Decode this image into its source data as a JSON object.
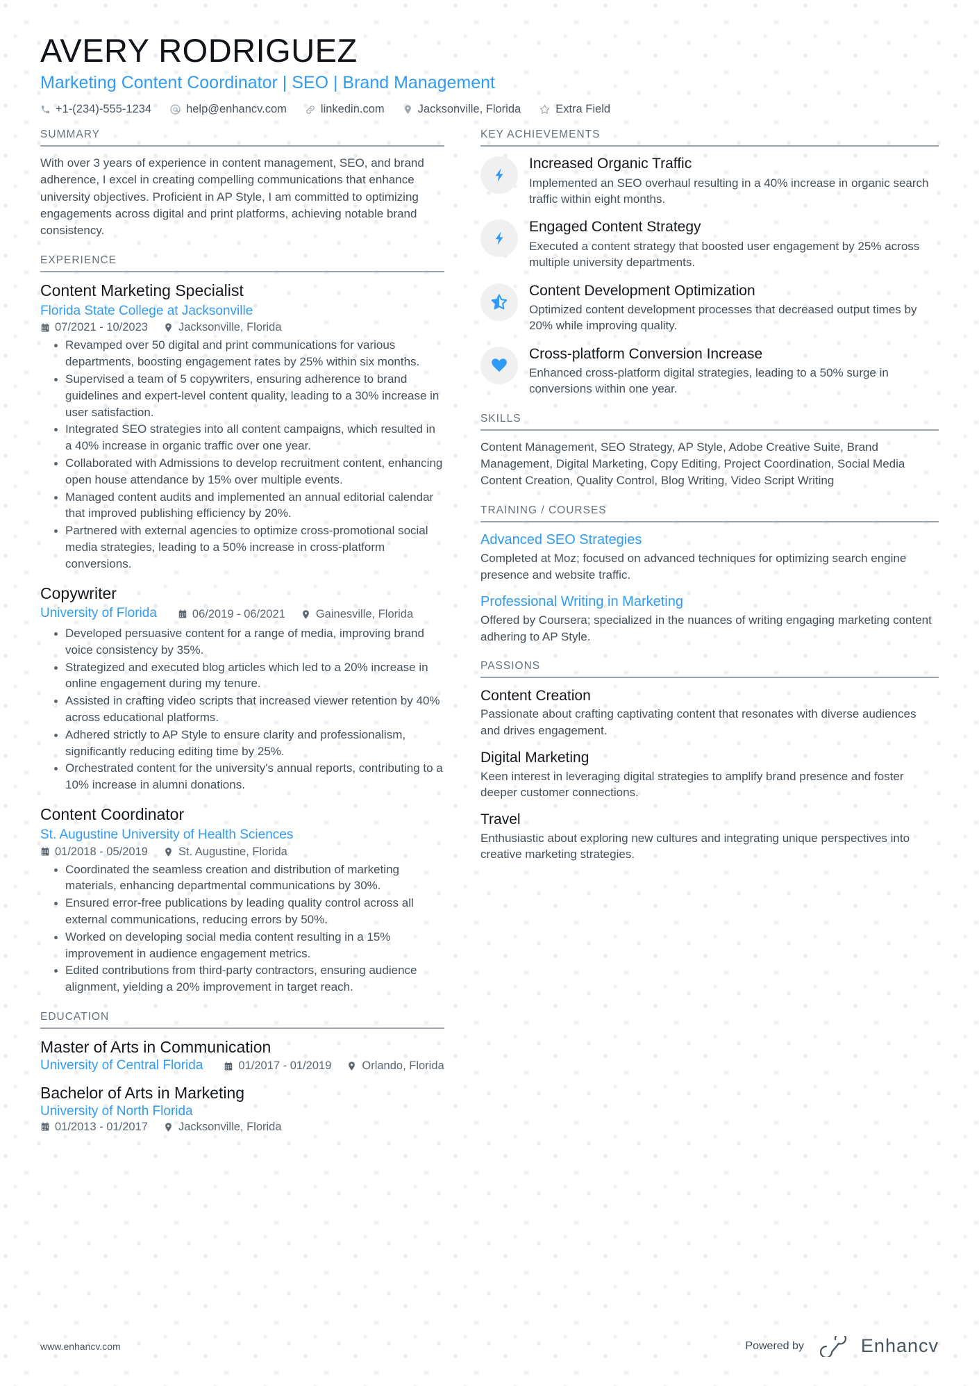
{
  "header": {
    "name": "AVERY RODRIGUEZ",
    "headline": "Marketing Content Coordinator | SEO | Brand Management",
    "contacts": [
      {
        "icon": "phone-icon",
        "text": "+1-(234)-555-1234"
      },
      {
        "icon": "email-icon",
        "text": "help@enhancv.com"
      },
      {
        "icon": "link-icon",
        "text": "linkedin.com"
      },
      {
        "icon": "location-icon",
        "text": "Jacksonville, Florida"
      },
      {
        "icon": "star-icon",
        "text": "Extra Field"
      }
    ]
  },
  "accent_color": "#2f9bf7",
  "left": {
    "summary": {
      "heading": "SUMMARY",
      "text": "With over 3 years of experience in content management, SEO, and brand adherence, I excel in creating compelling communications that enhance university objectives. Proficient in AP Style, I am committed to optimizing engagements across digital and print platforms, achieving notable brand consistency."
    },
    "experience": {
      "heading": "EXPERIENCE",
      "jobs": [
        {
          "title": "Content Marketing Specialist",
          "company": "Florida State College at Jacksonville",
          "dates": "07/2021 - 10/2023",
          "location": "Jacksonville, Florida",
          "inline_meta": false,
          "bullets": [
            "Revamped over 50 digital and print communications for various departments, boosting engagement rates by 25% within six months.",
            "Supervised a team of 5 copywriters, ensuring adherence to brand guidelines and expert-level content quality, leading to a 30% increase in user satisfaction.",
            "Integrated SEO strategies into all content campaigns, which resulted in a 40% increase in organic traffic over one year.",
            "Collaborated with Admissions to develop recruitment content, enhancing open house attendance by 15% over multiple events.",
            "Managed content audits and implemented an annual editorial calendar that improved publishing efficiency by 20%.",
            "Partnered with external agencies to optimize cross-promotional social media strategies, leading to a 50% increase in cross-platform conversions."
          ]
        },
        {
          "title": "Copywriter",
          "company": "University of Florida",
          "dates": "06/2019 - 06/2021",
          "location": "Gainesville, Florida",
          "inline_meta": true,
          "bullets": [
            "Developed persuasive content for a range of media, improving brand voice consistency by 35%.",
            "Strategized and executed blog articles which led to a 20% increase in online engagement during my tenure.",
            "Assisted in crafting video scripts that increased viewer retention by 40% across educational platforms.",
            "Adhered strictly to AP Style to ensure clarity and professionalism, significantly reducing editing time by 25%.",
            "Orchestrated content for the university's annual reports, contributing to a 10% increase in alumni donations."
          ]
        },
        {
          "title": "Content Coordinator",
          "company": "St. Augustine University of Health Sciences",
          "dates": "01/2018 - 05/2019",
          "location": "St. Augustine, Florida",
          "inline_meta": false,
          "bullets": [
            "Coordinated the seamless creation and distribution of marketing materials, enhancing departmental communications by 30%.",
            "Ensured error-free publications by leading quality control across all external communications, reducing errors by 50%.",
            "Worked on developing social media content resulting in a 15% improvement in audience engagement metrics.",
            "Edited contributions from third-party contractors, ensuring audience alignment, yielding a 20% improvement in target reach."
          ]
        }
      ]
    },
    "education": {
      "heading": "EDUCATION",
      "entries": [
        {
          "degree": "Master of Arts in Communication",
          "school": "University of Central Florida",
          "dates": "01/2017 - 01/2019",
          "location": "Orlando, Florida",
          "inline_meta": true
        },
        {
          "degree": "Bachelor of Arts in Marketing",
          "school": "University of North Florida",
          "dates": "01/2013 - 01/2017",
          "location": "Jacksonville, Florida",
          "inline_meta": false
        }
      ]
    }
  },
  "right": {
    "achievements": {
      "heading": "KEY ACHIEVEMENTS",
      "items": [
        {
          "icon": "lightning-bolt-icon",
          "title": "Increased Organic Traffic",
          "desc": "Implemented an SEO overhaul resulting in a 40% increase in organic search traffic within eight months."
        },
        {
          "icon": "lightning-bolt-icon",
          "title": "Engaged Content Strategy",
          "desc": "Executed a content strategy that boosted user engagement by 25% across multiple university departments."
        },
        {
          "icon": "star-half-icon",
          "title": "Content Development Optimization",
          "desc": "Optimized content development processes that decreased output times by 20% while improving quality."
        },
        {
          "icon": "heart-icon",
          "title": "Cross-platform Conversion Increase",
          "desc": "Enhanced cross-platform digital strategies, leading to a 50% surge in conversions within one year."
        }
      ]
    },
    "skills": {
      "heading": "SKILLS",
      "text": "Content Management, SEO Strategy, AP Style, Adobe Creative Suite, Brand Management, Digital Marketing, Copy Editing, Project Coordination, Social Media Content Creation, Quality Control, Blog Writing, Video Script Writing"
    },
    "training": {
      "heading": "TRAINING / COURSES",
      "courses": [
        {
          "title": "Advanced SEO Strategies",
          "desc": "Completed at Moz; focused on advanced techniques for optimizing search engine presence and website traffic."
        },
        {
          "title": "Professional Writing in Marketing",
          "desc": "Offered by Coursera; specialized in the nuances of writing engaging marketing content adhering to AP Style."
        }
      ]
    },
    "passions": {
      "heading": "PASSIONS",
      "items": [
        {
          "title": "Content Creation",
          "desc": "Passionate about crafting captivating content that resonates with diverse audiences and drives engagement."
        },
        {
          "title": "Digital Marketing",
          "desc": "Keen interest in leveraging digital strategies to amplify brand presence and foster deeper customer connections."
        },
        {
          "title": "Travel",
          "desc": "Enthusiastic about exploring new cultures and integrating unique perspectives into creative marketing strategies."
        }
      ]
    }
  },
  "footer": {
    "website": "www.enhancv.com",
    "powered_by": "Powered by",
    "brand": "Enhancv"
  }
}
